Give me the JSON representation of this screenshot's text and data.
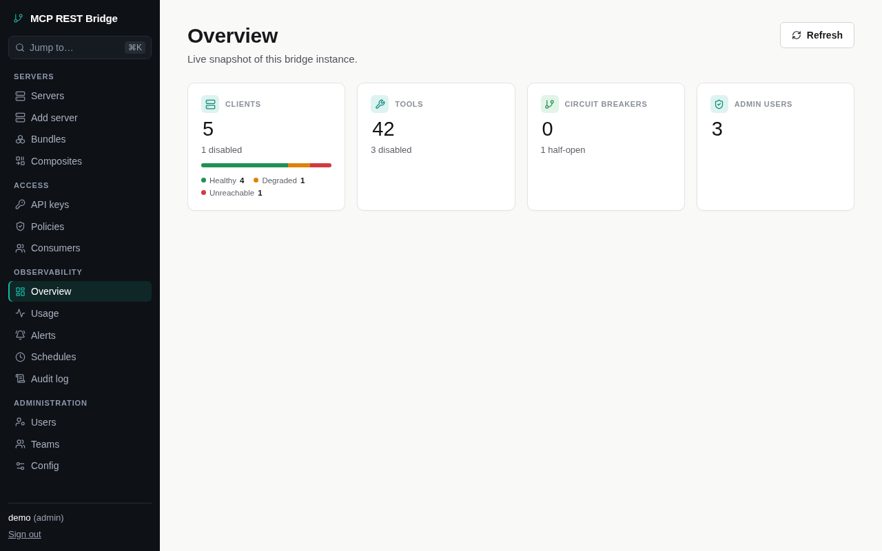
{
  "sidebar": {
    "brand": "MCP REST Bridge",
    "search": {
      "placeholder": "Jump to…",
      "shortcut": "⌘K"
    },
    "sections": [
      {
        "title": "SERVERS",
        "items": [
          {
            "label": "Servers",
            "selected": false
          },
          {
            "label": "Add server",
            "selected": false
          },
          {
            "label": "Bundles",
            "selected": false
          },
          {
            "label": "Composites",
            "selected": false
          }
        ]
      },
      {
        "title": "ACCESS",
        "items": [
          {
            "label": "API keys",
            "selected": false
          },
          {
            "label": "Policies",
            "selected": false
          },
          {
            "label": "Consumers",
            "selected": false
          }
        ]
      },
      {
        "title": "OBSERVABILITY",
        "items": [
          {
            "label": "Overview",
            "selected": true
          },
          {
            "label": "Usage",
            "selected": false
          },
          {
            "label": "Alerts",
            "selected": false
          },
          {
            "label": "Schedules",
            "selected": false
          },
          {
            "label": "Audit log",
            "selected": false
          }
        ]
      },
      {
        "title": "ADMINISTRATION",
        "items": [
          {
            "label": "Users",
            "selected": false
          },
          {
            "label": "Teams",
            "selected": false
          },
          {
            "label": "Config",
            "selected": false
          }
        ]
      }
    ],
    "user": {
      "name": "demo",
      "role": "(admin)"
    },
    "sign_out": "Sign out"
  },
  "header": {
    "title": "Overview",
    "subtitle": "Live snapshot of this bridge instance.",
    "refresh_button": "Refresh"
  },
  "stat_cards": [
    {
      "label": "CLIENTS",
      "value": "5",
      "note": "1 disabled",
      "breakdown": [
        {
          "label": "Healthy",
          "count": "4",
          "color": "#1e9154"
        },
        {
          "label": "Degraded",
          "count": "1",
          "color": "#de820a"
        },
        {
          "label": "Unreachable",
          "count": "1",
          "color": "#d23a3f"
        }
      ]
    },
    {
      "label": "TOOLS",
      "value": "42",
      "note": "3 disabled"
    },
    {
      "label": "CIRCUIT BREAKERS",
      "value": "0",
      "note": "1 half-open"
    },
    {
      "label": "ADMIN USERS",
      "value": "3"
    }
  ]
}
